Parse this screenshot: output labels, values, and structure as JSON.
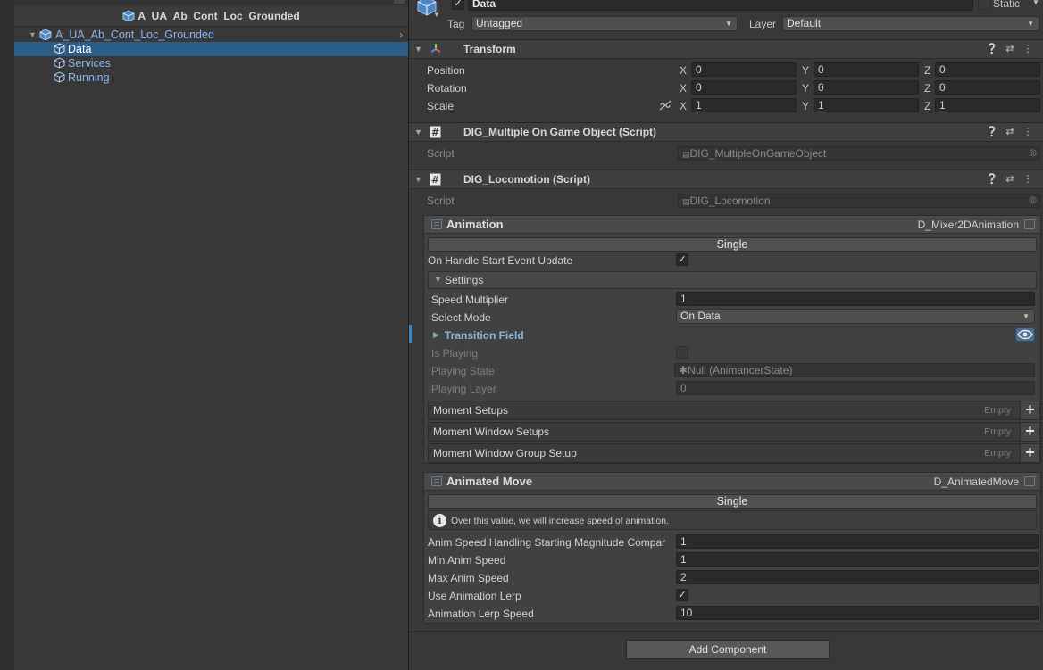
{
  "hierarchy": {
    "scene_title": "A_UA_Ab_Cont_Loc_Grounded",
    "root": "A_UA_Ab_Cont_Loc_Grounded",
    "children": [
      "Data",
      "Services",
      "Running"
    ]
  },
  "inspector": {
    "object_name": "Data",
    "static_label": "Static",
    "tag_label": "Tag",
    "tag_value": "Untagged",
    "layer_label": "Layer",
    "layer_value": "Default",
    "transform": {
      "title": "Transform",
      "position_label": "Position",
      "rotation_label": "Rotation",
      "scale_label": "Scale",
      "axes": [
        "X",
        "Y",
        "Z"
      ],
      "position": [
        "0",
        "0",
        "0"
      ],
      "rotation": [
        "0",
        "0",
        "0"
      ],
      "scale": [
        "1",
        "1",
        "1"
      ]
    },
    "multiple_script": {
      "title": "DIG_Multiple On Game Object (Script)",
      "script_label": "Script",
      "script_value": "DIG_MultipleOnGameObject"
    },
    "locomotion": {
      "title": "DIG_Locomotion (Script)",
      "script_label": "Script",
      "script_value": "DIG_Locomotion",
      "animation": {
        "title": "Animation",
        "type": "D_Mixer2DAnimation",
        "mode_bar": "Single",
        "on_handle_label": "On Handle Start Event Update",
        "settings_label": "Settings",
        "speed_multiplier_label": "Speed Multiplier",
        "speed_multiplier": "1",
        "select_mode_label": "Select Mode",
        "select_mode": "On Data",
        "transition_field_label": "Transition Field",
        "is_playing_label": "Is Playing",
        "playing_state_label": "Playing State",
        "playing_state": "Null (AnimancerState)",
        "playing_layer_label": "Playing Layer",
        "playing_layer": "0",
        "lists": [
          {
            "label": "Moment Setups",
            "empty": "Empty"
          },
          {
            "label": "Moment Window Setups",
            "empty": "Empty"
          },
          {
            "label": "Moment Window Group Setup",
            "empty": "Empty"
          }
        ]
      },
      "animated_move": {
        "title": "Animated Move",
        "type": "D_AnimatedMove",
        "mode_bar": "Single",
        "info": "Over this value, we will increase speed of animation.",
        "anim_speed_handling_label": "Anim Speed Handling Starting Magnitude Compar",
        "anim_speed_handling": "1",
        "min_anim_speed_label": "Min Anim Speed",
        "min_anim_speed": "1",
        "max_anim_speed_label": "Max Anim Speed",
        "max_anim_speed": "2",
        "use_lerp_label": "Use Animation Lerp",
        "lerp_speed_label": "Animation Lerp Speed",
        "lerp_speed": "10"
      }
    },
    "add_component": "Add Component"
  }
}
